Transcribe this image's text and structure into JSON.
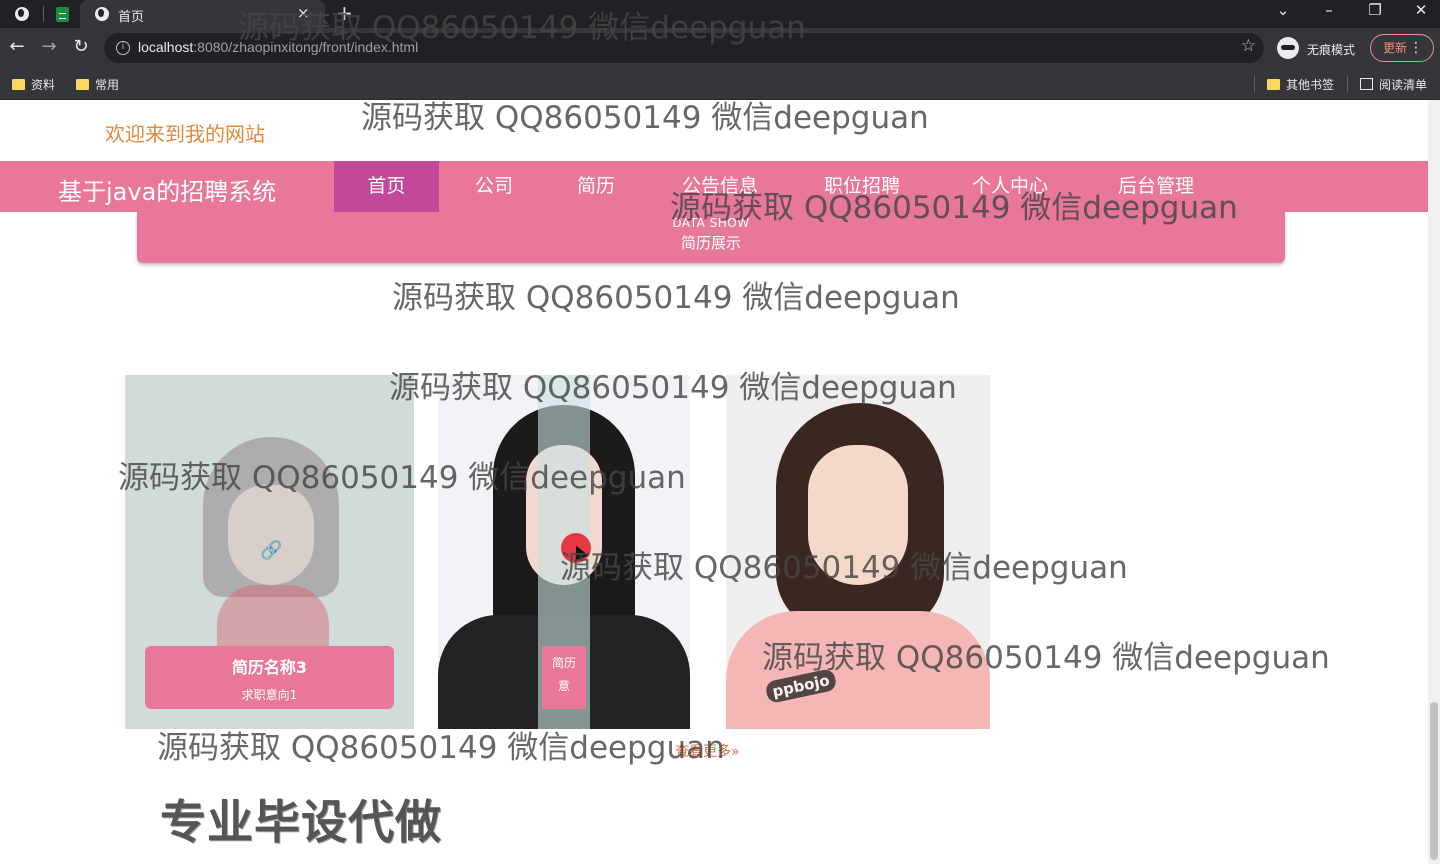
{
  "browser": {
    "tab_title": "首页",
    "tab_close_glyph": "×",
    "new_tab_glyph": "+",
    "url_host": "localhost",
    "url_path": ":8080/zhaopinxitong/front/index.html",
    "incognito_label": "无痕模式",
    "update_label": "更新",
    "bookmarks": [
      "资料",
      "常用"
    ],
    "other_bookmarks": "其他书签",
    "reading_list": "阅读清单"
  },
  "site": {
    "welcome": "欢迎来到我的网站",
    "brand": "基于java的招聘系统",
    "nav": [
      "首页",
      "公司",
      "简历",
      "公告信息",
      "职位招聘",
      "个人中心",
      "后台管理"
    ],
    "active_nav_index": 0,
    "section_en": "DATA SHOW",
    "section_cn": "简历展示",
    "cards": [
      {
        "name": "简历名称3",
        "intent": "求职意向1"
      },
      {
        "name": "简历",
        "intent": "意"
      }
    ],
    "more_link": "查看更多»",
    "ad_banner": "专业毕设代做"
  },
  "watermark": "源码获取 QQ86050149 微信deepguan",
  "colors": {
    "accent_pink": "#e8779a",
    "active_nav": "#c2489a",
    "welcome_orange": "#e08a3a",
    "more_link": "#e06a36"
  }
}
